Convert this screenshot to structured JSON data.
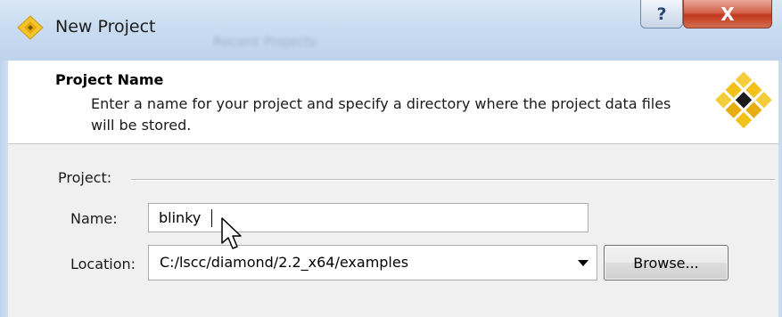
{
  "window": {
    "title": "New Project",
    "background_text": [
      "Recent Projects"
    ],
    "help_label": "?",
    "close_label": "X"
  },
  "header": {
    "title": "Project Name",
    "description": "Enter a name for your project and specify a directory where the project data files will be stored."
  },
  "project_group": {
    "label": "Project:"
  },
  "name_field": {
    "label": "Name:",
    "value": "blinky"
  },
  "location_field": {
    "label": "Location:",
    "value": "C:/lscc/diamond/2.2_x64/examples"
  },
  "browse_button": {
    "label": "Browse..."
  },
  "colors": {
    "titlebar": "#c9dcf1",
    "close_button": "#c0391f",
    "body_panel": "#f0f0f0",
    "logo_gold": "#f2c21b",
    "logo_dark": "#1b1b1b"
  },
  "icons": [
    "app-diamond-icon",
    "help-icon",
    "close-icon",
    "diamond-logo-icon",
    "dropdown-arrow-icon",
    "mouse-cursor-icon"
  ]
}
